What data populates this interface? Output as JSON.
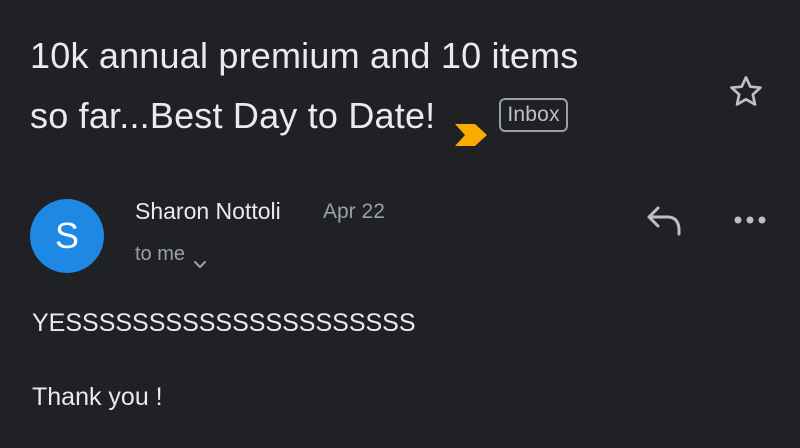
{
  "email": {
    "subject_line1": "10k annual premium and 10 items",
    "subject_line2": "so far...Best Day to Date!",
    "label": "Inbox",
    "sender_name": "Sharon Nottoli",
    "sender_initial": "S",
    "date": "Apr 22",
    "recipient": "to me",
    "body": [
      "YESSSSSSSSSSSSSSSSSSSSS",
      "Thank you !"
    ]
  },
  "icons": {
    "importance": "importance-marker-icon",
    "star": "star-outline-icon",
    "reply": "reply-icon",
    "more": "more-options-icon",
    "chevron": "chevron-down-icon"
  },
  "colors": {
    "background": "#202124",
    "avatar": "#1e88e5",
    "importance": "#f9ab00",
    "text": "#e8eaed",
    "secondary_text": "#9aa0a6"
  }
}
